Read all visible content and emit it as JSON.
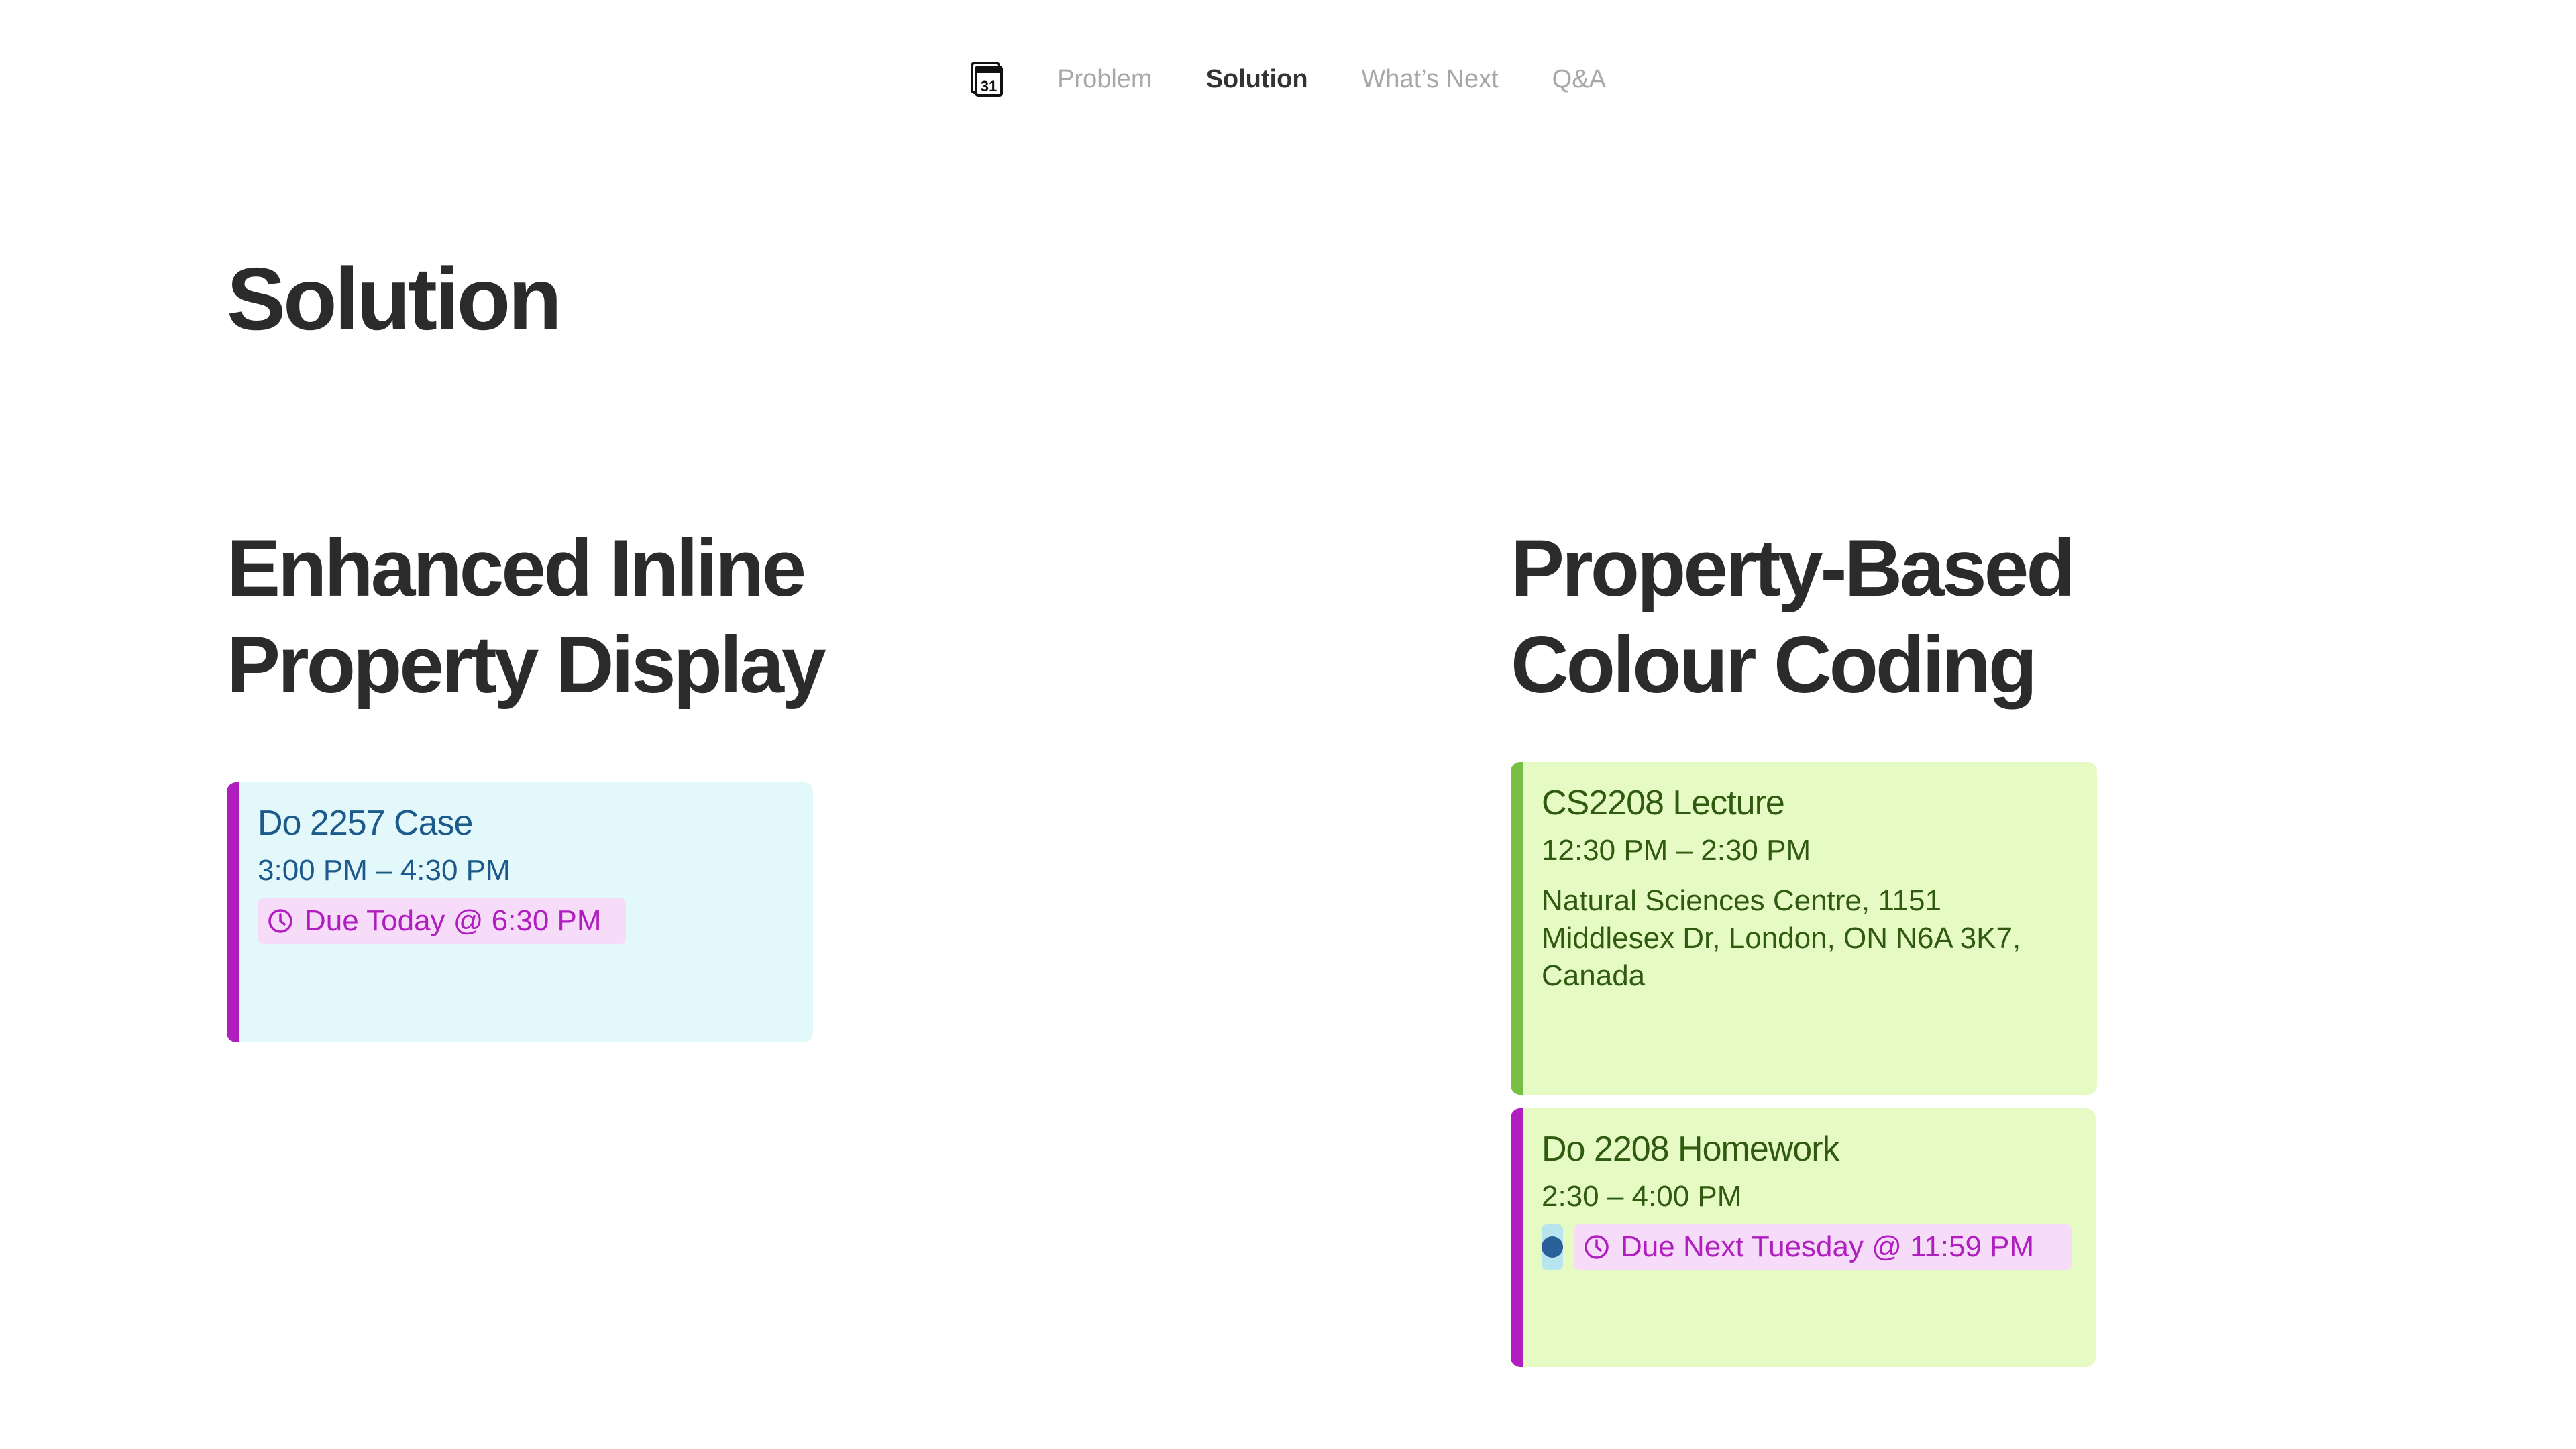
{
  "nav": {
    "logo_icon": "calendar-31-icon",
    "logo_text": "31",
    "items": [
      {
        "label": "Problem",
        "active": false
      },
      {
        "label": "Solution",
        "active": true
      },
      {
        "label": "What’s Next",
        "active": false
      },
      {
        "label": "Q&A",
        "active": false
      }
    ]
  },
  "page": {
    "title": "Solution"
  },
  "left_section": {
    "title_line1": "Enhanced Inline",
    "title_line2": "Property Display",
    "card": {
      "title": "Do 2257 Case",
      "time": "3:00 PM – 4:30 PM",
      "due": "Due Today @ 6:30 PM",
      "due_icon": "clock-icon",
      "background": "#e3f8fb",
      "accent": "#b01ec0",
      "text_color": "#1d5a8c"
    }
  },
  "right_section": {
    "title_line1": "Property-Based",
    "title_line2": "Colour Coding",
    "cards": [
      {
        "title": "CS2208 Lecture",
        "time": "12:30 PM – 2:30 PM",
        "location": "Natural Sciences Centre, 1151 Middlesex Dr, London, ON N6A 3K7, Canada",
        "background": "#e6fbc3",
        "accent": "#78c043",
        "text_color": "#2f5a10"
      },
      {
        "title": "Do 2208 Homework",
        "time": "2:30 – 4:00 PM",
        "status_icon": "status-dot-icon",
        "due": "Due Next Tuesday @ 11:59 PM",
        "due_icon": "clock-icon",
        "background": "#e6fbc3",
        "accent": "#b01ec0",
        "text_color": "#2f5a10"
      }
    ]
  },
  "colors": {
    "due_chip_background": "#f6dcf8",
    "due_chip_text": "#b01ec0",
    "status_chip_background": "#b8e4ef",
    "status_dot": "#2a5f97",
    "nav_inactive": "#a8a8a8",
    "nav_active": "#333333"
  }
}
